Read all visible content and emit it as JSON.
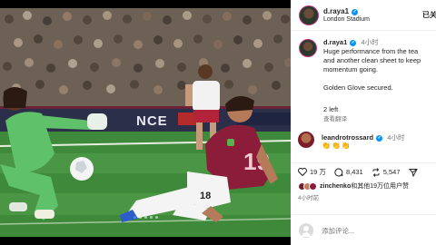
{
  "post": {
    "username": "d.raya1",
    "location": "London Stadium",
    "follow_label": "已关"
  },
  "caption": {
    "username": "d.raya1",
    "time": "4小时",
    "lines": [
      "Huge performance from the tea",
      "and another clean sheet to keep",
      "momentum going."
    ],
    "line_extra": "Golden Glove secured.",
    "more": "2 left",
    "translate": "查看翻译"
  },
  "comment": {
    "username": "leandrotrossard",
    "time": "4小时",
    "emojis": "👏👏👏"
  },
  "actions": {
    "likes": "19 万",
    "comments": "8,431",
    "reposts": "5,547"
  },
  "likers": {
    "name": "zinchenko",
    "rest": "和其他19万位用户赞"
  },
  "timestamp": "4小时前",
  "add_comment": {
    "placeholder": "添加评论..."
  },
  "carousel": {
    "count": 5,
    "active_index": 0
  },
  "colors": {
    "verified": "#0095f6",
    "story_ring": "#c13584",
    "arsenal_red": "#8b1d3a",
    "keeper_green": "#5fc26a"
  }
}
